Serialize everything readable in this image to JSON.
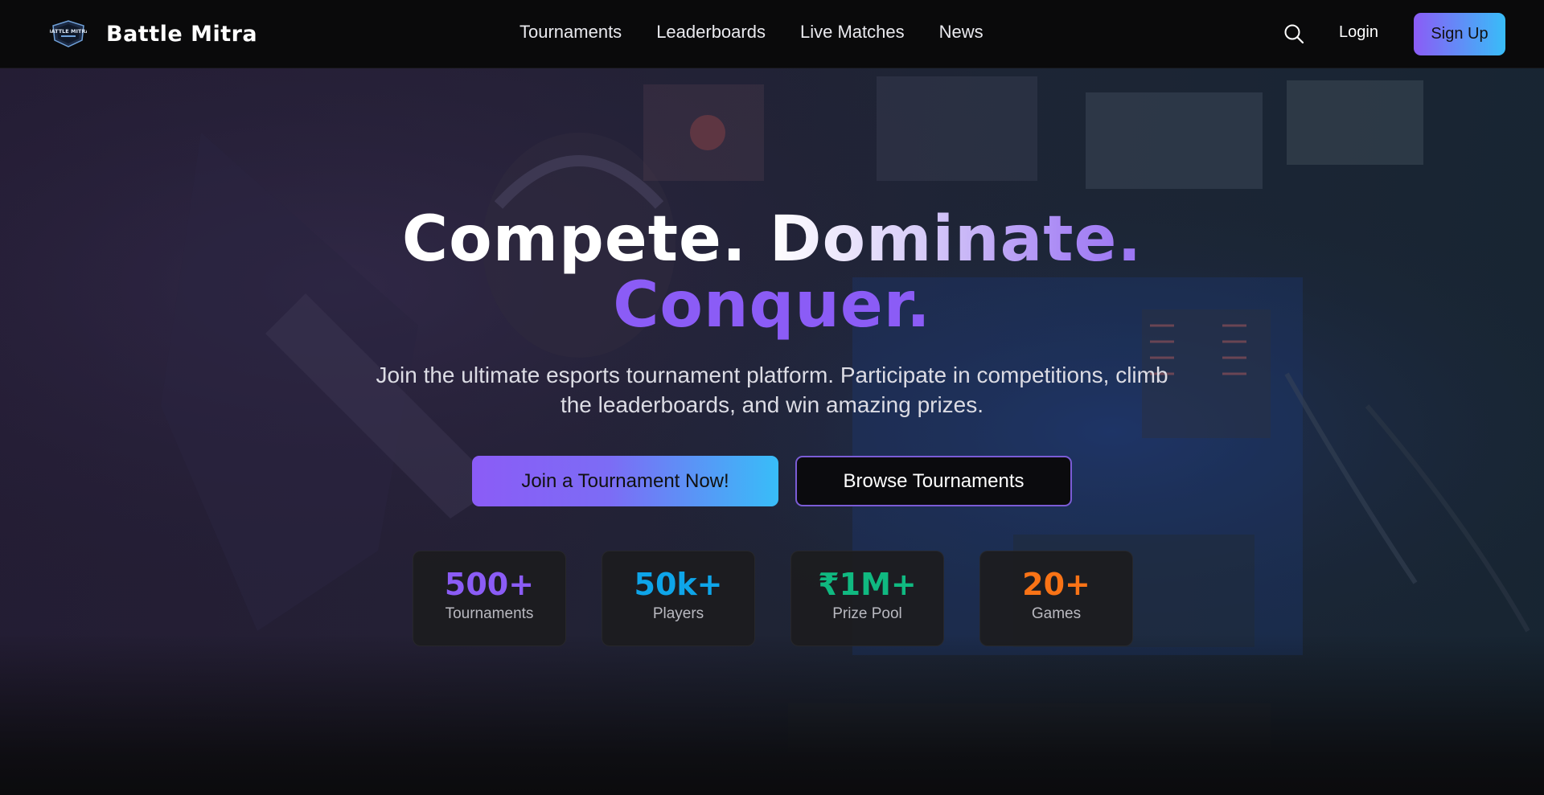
{
  "brand": {
    "name": "Battle Mitra",
    "logo_icon": "battle-mitra-shield-logo",
    "logo_text": "BATTLE MITRA"
  },
  "nav": {
    "links": [
      "Tournaments",
      "Leaderboards",
      "Live Matches",
      "News"
    ],
    "search_icon": "search-icon",
    "login_label": "Login",
    "signup_label": "Sign Up"
  },
  "hero": {
    "headline_compete": "Compete.",
    "headline_dominate": "Dominate.",
    "headline_conquer": "Conquer.",
    "subtitle": "Join the ultimate esports tournament platform. Participate in competitions, climb the leaderboards, and win amazing prizes.",
    "primary_cta": "Join a Tournament Now!",
    "secondary_cta": "Browse Tournaments",
    "stats": [
      {
        "value": "500+",
        "label": "Tournaments",
        "color": "#8b5cf6"
      },
      {
        "value": "50k+",
        "label": "Players",
        "color": "#0ea5e9"
      },
      {
        "value": "₹1M+",
        "label": "Prize Pool",
        "color": "#10b981"
      },
      {
        "value": "20+",
        "label": "Games",
        "color": "#f97316"
      }
    ]
  },
  "colors": {
    "accent_purple": "#8b5cf6",
    "accent_blue": "#38bdf8",
    "nav_bg": "#0a0a0b"
  }
}
